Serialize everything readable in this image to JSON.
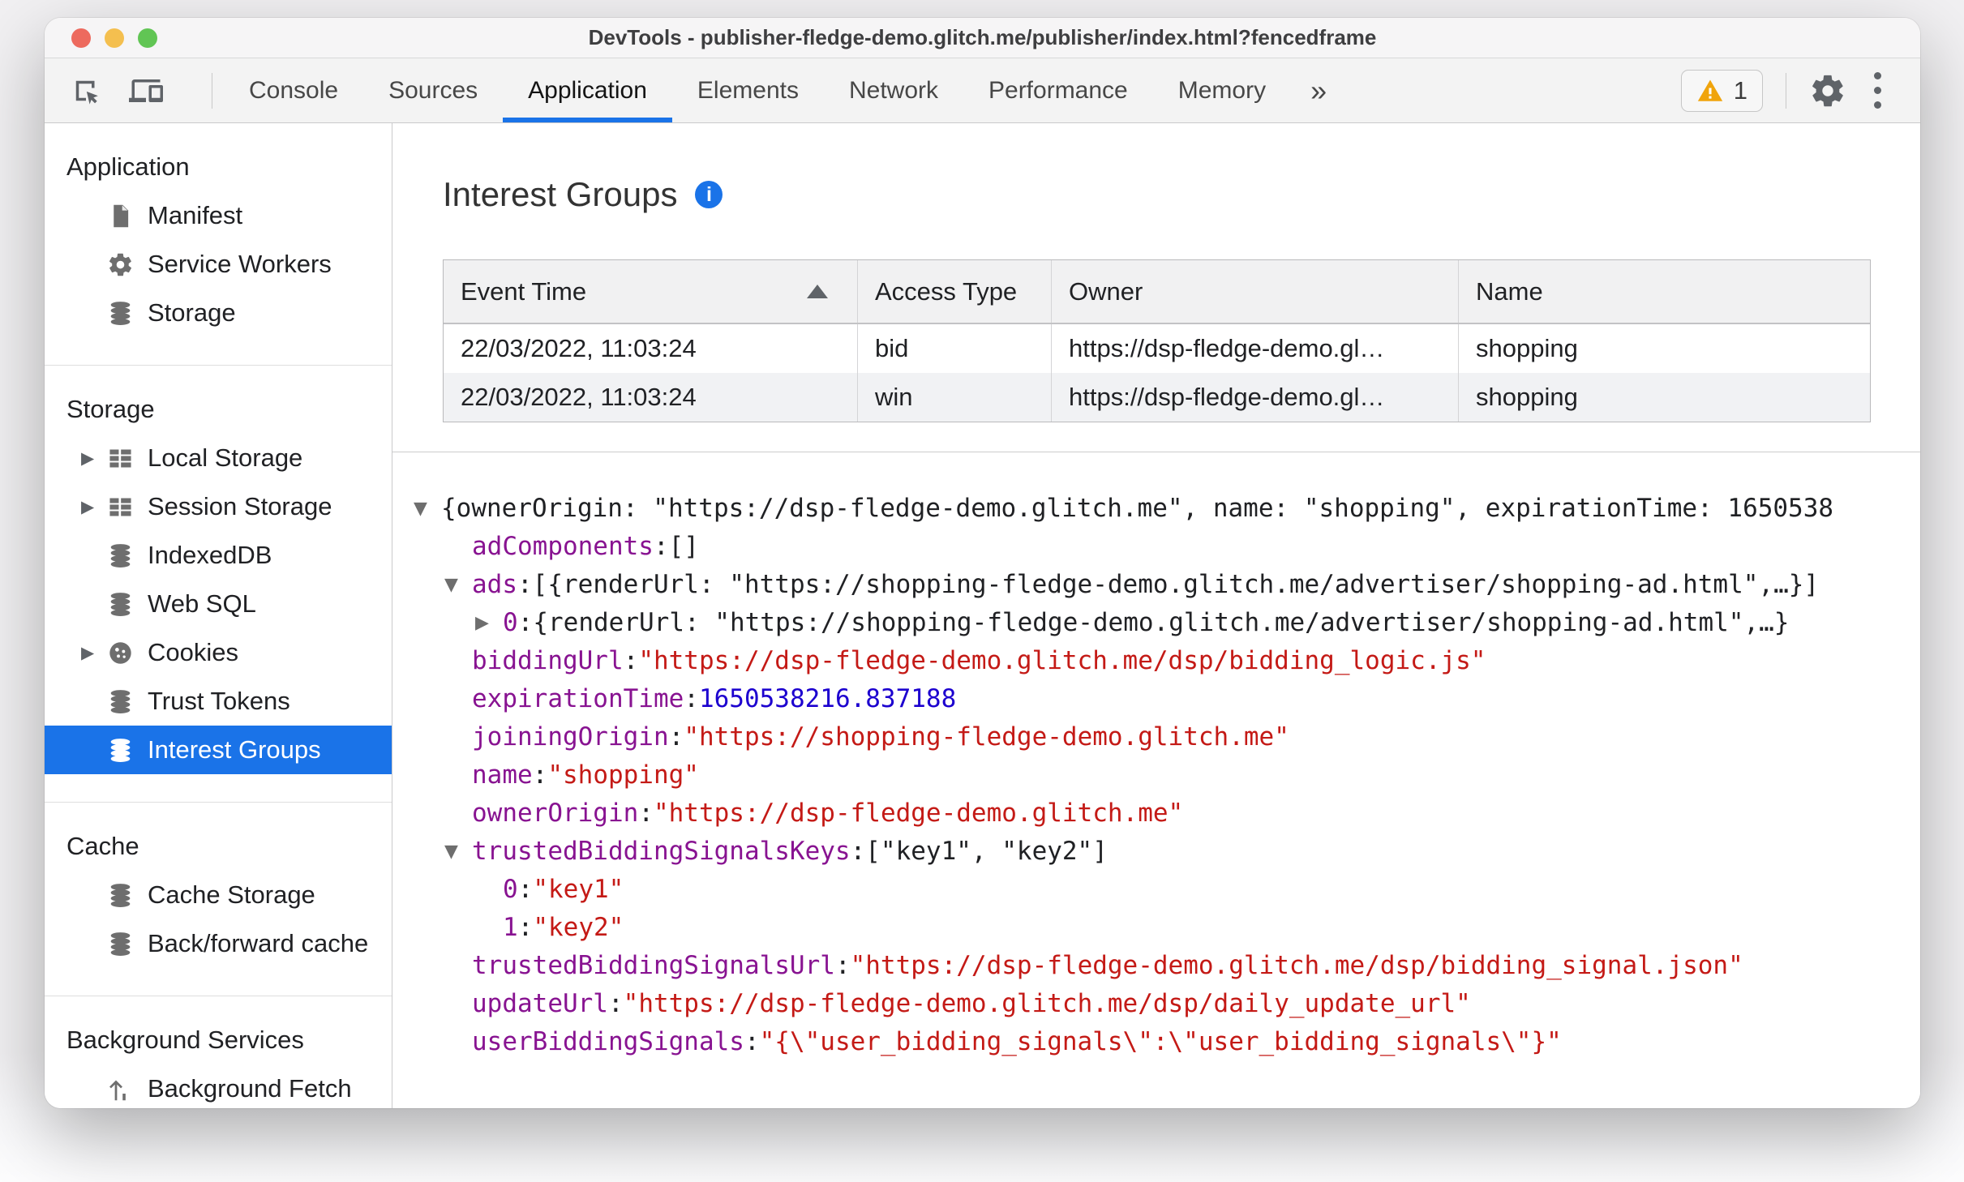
{
  "colors": {
    "accent_blue": "#1a73e8",
    "selected_row_blue": "#1a73e8",
    "key_purple": "#881391",
    "string_red": "#c41a16",
    "number_blue": "#1c00cf",
    "warning_amber": "#f0a40c"
  },
  "window": {
    "title": "DevTools - publisher-fledge-demo.glitch.me/publisher/index.html?fencedframe"
  },
  "toolbar": {
    "tabs": [
      "Console",
      "Sources",
      "Application",
      "Elements",
      "Network",
      "Performance",
      "Memory"
    ],
    "selected_tab": "Application",
    "more_tabs_label": "»",
    "warning_count": "1"
  },
  "sidebar": {
    "sections": [
      {
        "header": "Application",
        "items": [
          {
            "icon": "file-icon",
            "label": "Manifest"
          },
          {
            "icon": "gear-icon",
            "label": "Service Workers"
          },
          {
            "icon": "database-icon",
            "label": "Storage"
          }
        ]
      },
      {
        "header": "Storage",
        "items": [
          {
            "icon": "table-icon",
            "label": "Local Storage",
            "expandable": true
          },
          {
            "icon": "table-icon",
            "label": "Session Storage",
            "expandable": true
          },
          {
            "icon": "database-icon",
            "label": "IndexedDB"
          },
          {
            "icon": "database-icon",
            "label": "Web SQL"
          },
          {
            "icon": "cookie-icon",
            "label": "Cookies",
            "expandable": true
          },
          {
            "icon": "database-icon",
            "label": "Trust Tokens"
          },
          {
            "icon": "database-icon",
            "label": "Interest Groups",
            "selected": true
          }
        ]
      },
      {
        "header": "Cache",
        "items": [
          {
            "icon": "database-icon",
            "label": "Cache Storage"
          },
          {
            "icon": "database-icon",
            "label": "Back/forward cache"
          }
        ]
      },
      {
        "header": "Background Services",
        "items": [
          {
            "icon": "fetch-icon",
            "label": "Background Fetch"
          }
        ]
      }
    ]
  },
  "main": {
    "title": "Interest Groups",
    "table": {
      "headers": [
        "Event Time",
        "Access Type",
        "Owner",
        "Name"
      ],
      "sort_column": "Event Time",
      "sort_direction": "ascending",
      "rows": [
        [
          "22/03/2022, 11:03:24",
          "bid",
          "https://dsp-fledge-demo.gl…",
          "shopping"
        ],
        [
          "22/03/2022, 11:03:24",
          "win",
          "https://dsp-fledge-demo.gl…",
          "shopping"
        ]
      ]
    },
    "tree": {
      "lines": [
        {
          "ind": 0,
          "arw": "d",
          "k": "",
          "v": "{ownerOrigin: \"https://dsp-fledge-demo.glitch.me\", name: \"shopping\", expirationTime: 1650538",
          "vc": "p"
        },
        {
          "ind": 1,
          "arw": "",
          "k": "adComponents",
          "v": "[]",
          "vc": "p"
        },
        {
          "ind": 1,
          "arw": "d",
          "k": "ads",
          "v": "[{renderUrl: \"https://shopping-fledge-demo.glitch.me/advertiser/shopping-ad.html\",…}]",
          "vc": "p"
        },
        {
          "ind": 2,
          "arw": "r",
          "k": "0",
          "v": "{renderUrl: \"https://shopping-fledge-demo.glitch.me/advertiser/shopping-ad.html\",…}",
          "vc": "p"
        },
        {
          "ind": 1,
          "arw": "",
          "k": "biddingUrl",
          "v": "\"https://dsp-fledge-demo.glitch.me/dsp/bidding_logic.js\"",
          "vc": "s"
        },
        {
          "ind": 1,
          "arw": "",
          "k": "expirationTime",
          "v": "1650538216.837188",
          "vc": "n"
        },
        {
          "ind": 1,
          "arw": "",
          "k": "joiningOrigin",
          "v": "\"https://shopping-fledge-demo.glitch.me\"",
          "vc": "s"
        },
        {
          "ind": 1,
          "arw": "",
          "k": "name",
          "v": "\"shopping\"",
          "vc": "s"
        },
        {
          "ind": 1,
          "arw": "",
          "k": "ownerOrigin",
          "v": "\"https://dsp-fledge-demo.glitch.me\"",
          "vc": "s"
        },
        {
          "ind": 1,
          "arw": "d",
          "k": "trustedBiddingSignalsKeys",
          "v": "[\"key1\", \"key2\"]",
          "vc": "p"
        },
        {
          "ind": 2,
          "arw": "",
          "k": "0",
          "v": "\"key1\"",
          "vc": "s"
        },
        {
          "ind": 2,
          "arw": "",
          "k": "1",
          "v": "\"key2\"",
          "vc": "s"
        },
        {
          "ind": 1,
          "arw": "",
          "k": "trustedBiddingSignalsUrl",
          "v": "\"https://dsp-fledge-demo.glitch.me/dsp/bidding_signal.json\"",
          "vc": "s"
        },
        {
          "ind": 1,
          "arw": "",
          "k": "updateUrl",
          "v": "\"https://dsp-fledge-demo.glitch.me/dsp/daily_update_url\"",
          "vc": "s"
        },
        {
          "ind": 1,
          "arw": "",
          "k": "userBiddingSignals",
          "v": "\"{\\\"user_bidding_signals\\\":\\\"user_bidding_signals\\\"}\"",
          "vc": "s"
        }
      ]
    }
  }
}
